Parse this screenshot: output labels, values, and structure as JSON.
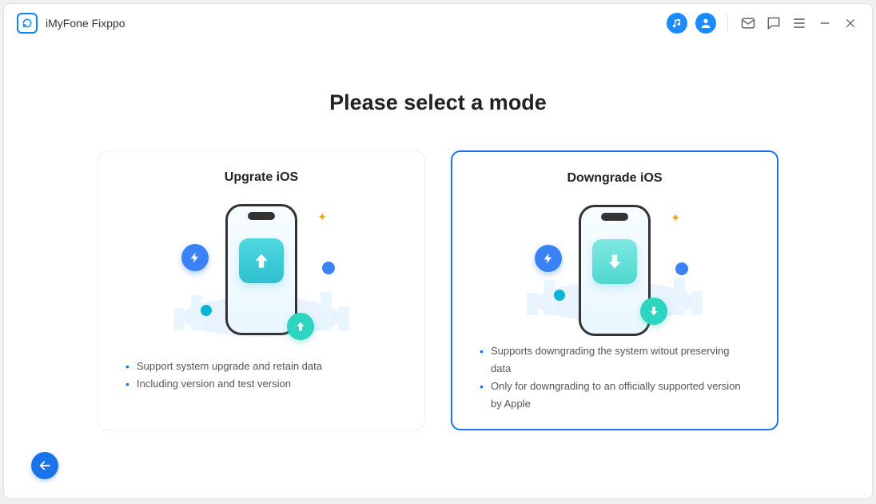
{
  "app": {
    "title": "iMyFone Fixppo"
  },
  "page": {
    "heading": "Please select a mode"
  },
  "cards": {
    "upgrade": {
      "title": "Upgrate iOS",
      "bullet1": "Support system upgrade and retain data",
      "bullet2": "Including version and test version"
    },
    "downgrade": {
      "title": "Downgrade iOS",
      "bullet1": "Supports downgrading the system witout preserving data",
      "bullet2": "Only for downgrading to an officially supported version by Apple"
    }
  }
}
